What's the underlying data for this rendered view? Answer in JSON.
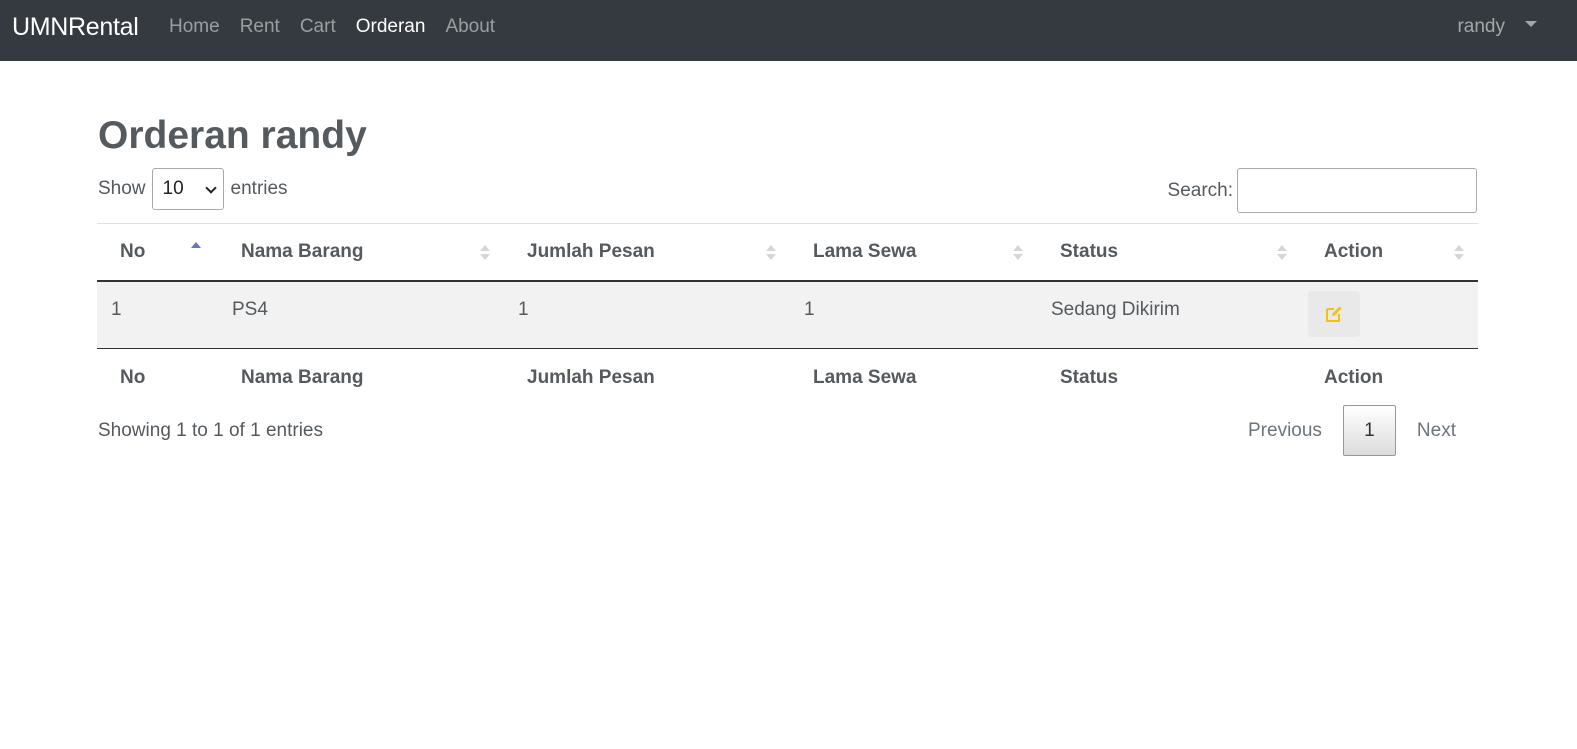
{
  "navbar": {
    "brand": "UMNRental",
    "links": [
      "Home",
      "Rent",
      "Cart",
      "Orderan",
      "About"
    ],
    "active": "Orderan",
    "user": "randy"
  },
  "page": {
    "title": "Orderan randy"
  },
  "length": {
    "show_label": "Show",
    "selected": "10",
    "entries_label": "entries"
  },
  "search": {
    "label": "Search:",
    "value": ""
  },
  "table": {
    "columns": [
      "No",
      "Nama Barang",
      "Jumlah Pesan",
      "Lama Sewa",
      "Status",
      "Action"
    ],
    "rows": [
      {
        "no": "1",
        "nama_barang": "PS4",
        "jumlah_pesan": "1",
        "lama_sewa": "1",
        "status": "Sedang Dikirim"
      }
    ]
  },
  "info": "Showing 1 to 1 of 1 entries",
  "pagination": {
    "previous": "Previous",
    "current": "1",
    "next": "Next"
  },
  "colors": {
    "navbar_bg": "#343a40",
    "sort_active": "#6673c9",
    "edit_icon": "#f4c20d"
  },
  "icons": {
    "user_dropdown": "caret-down-icon",
    "action_edit": "edit-icon"
  }
}
